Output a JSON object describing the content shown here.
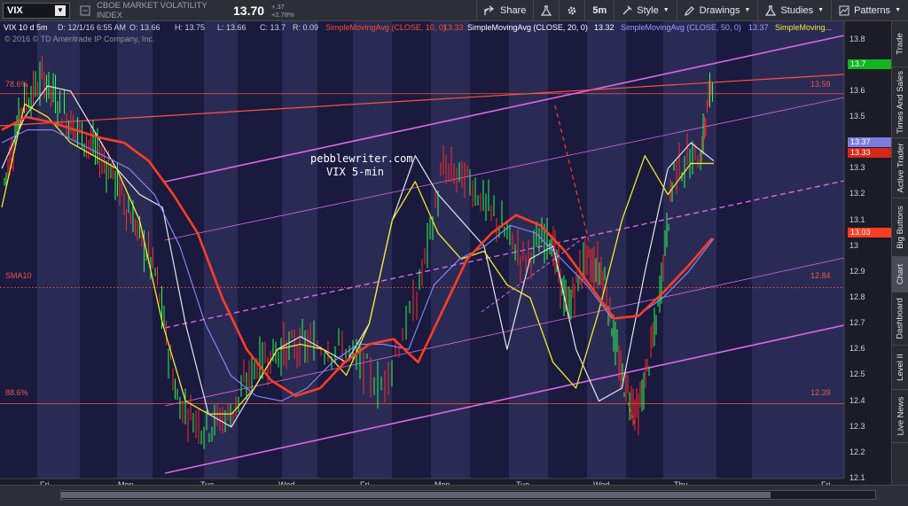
{
  "toolbar": {
    "symbol": "VIX",
    "description": "CBOE MARKET VOLATILITY INDEX",
    "last": "13.70",
    "change": "+.37",
    "change_pct": "+2.78%",
    "share": "Share",
    "timeframe": "5m",
    "style": "Style",
    "drawings": "Drawings",
    "studies": "Studies",
    "patterns": "Patterns"
  },
  "sidetabs": [
    "Trade",
    "Times And Sales",
    "Active Trader",
    "Big Buttons",
    "Chart",
    "Dashboard",
    "Level II",
    "Live News"
  ],
  "header": {
    "title": "VIX 10 d 5m",
    "date": "D: 12/1/16 6:55 AM",
    "open": "O: 13.66",
    "high": "H: 13.75",
    "low": "L: 13.66",
    "close": "C: 13.7",
    "range": "R: 0.09",
    "sma10": "SimpleMovingAvg (CLOSE, 10, 0)",
    "sma10_val": "13.33",
    "sma20": "SimpleMovingAvg (CLOSE, 20, 0)",
    "sma20_val": "13.32",
    "sma50": "SimpleMovingAvg (CLOSE, 50, 0)",
    "sma50_val": "13.37",
    "sma_more": "SimpleMoving...",
    "copyright": "© 2016 © TD Ameritrade IP Company, Inc."
  },
  "annotation": {
    "line1": "pebblewriter.com",
    "line2": "VIX 5-min"
  },
  "levels": {
    "fib786": "78.6%",
    "fib786_val": "13.59",
    "sma10_label": "SMA10",
    "sma10_level": "12.84",
    "fib886": "88.6%",
    "fib886_val": "12.39"
  },
  "price_tags": {
    "last": "13.7",
    "sma50": "13.37",
    "sma10": "13.33",
    "red_end": "13.03",
    "level_1359": "13.59",
    "level_1284": "12.84",
    "level_1239": "12.39"
  },
  "colors": {
    "background": "#1b1c27",
    "band_dark": "#191a3e",
    "band_light": "#2a2b55",
    "sma10": "#ff3d24",
    "sma20": "#f2ea2a",
    "sma50": "#8b8cff",
    "channel": "#e067e6",
    "level": "#ff5040",
    "up": "#28ff4a",
    "down": "#ff2a2a"
  },
  "chart_data": {
    "type": "line",
    "title": "VIX 10 d 5m",
    "x": [
      "Fri",
      "Mon",
      "Tue",
      "Wed",
      "Fri",
      "Mon",
      "Tue",
      "Wed",
      "Thu",
      "Fri"
    ],
    "ylim": [
      12.1,
      13.85
    ],
    "y_ticks": [
      "13.8",
      "13.7",
      "13.6",
      "13.5",
      "13.4",
      "13.3",
      "13.2",
      "13.1",
      "13",
      "12.9",
      "12.8",
      "12.7",
      "12.6",
      "12.5",
      "12.4",
      "12.3",
      "12.2",
      "12.1"
    ],
    "series": [
      {
        "name": "SimpleMovingAvg (CLOSE, 10, 0)",
        "values": [
          13.3,
          13.5,
          13.62,
          13.6,
          13.45,
          13.3,
          13.2,
          13.15,
          12.7,
          12.35,
          12.3,
          12.45,
          12.6,
          12.65,
          12.6,
          12.55,
          12.7,
          13.1,
          13.35,
          13.2,
          13.1,
          13.0,
          12.6,
          12.95,
          13.0,
          12.6,
          12.4,
          12.45,
          12.9,
          13.3,
          13.4,
          13.33
        ]
      },
      {
        "name": "SimpleMovingAvg (CLOSE, 20, 0)",
        "values": [
          13.15,
          13.55,
          13.5,
          13.4,
          13.35,
          13.3,
          13.1,
          12.7,
          12.4,
          12.35,
          12.35,
          12.45,
          12.6,
          12.62,
          12.6,
          12.5,
          12.7,
          13.1,
          13.25,
          13.05,
          12.95,
          12.98,
          12.85,
          12.8,
          12.55,
          12.45,
          12.75,
          13.1,
          13.35,
          13.2,
          13.32,
          13.32
        ]
      },
      {
        "name": "SimpleMovingAvg (CLOSE, 50, 0)",
        "values": [
          13.4,
          13.45,
          13.45,
          13.4,
          13.35,
          13.3,
          13.2,
          13.0,
          12.7,
          12.5,
          12.42,
          12.4,
          12.45,
          12.55,
          12.62,
          12.62,
          12.6,
          12.85,
          12.95,
          13.0,
          13.08,
          13.05,
          12.95,
          12.85,
          12.72,
          12.73,
          12.8,
          12.9,
          13.03
        ]
      }
    ],
    "levels": [
      {
        "label": "78.6%",
        "value": 13.59
      },
      {
        "label": "SMA10",
        "value": 12.84
      },
      {
        "label": "88.6%",
        "value": 12.39
      }
    ],
    "last_price": 13.7,
    "grid": false,
    "legend": "top"
  }
}
